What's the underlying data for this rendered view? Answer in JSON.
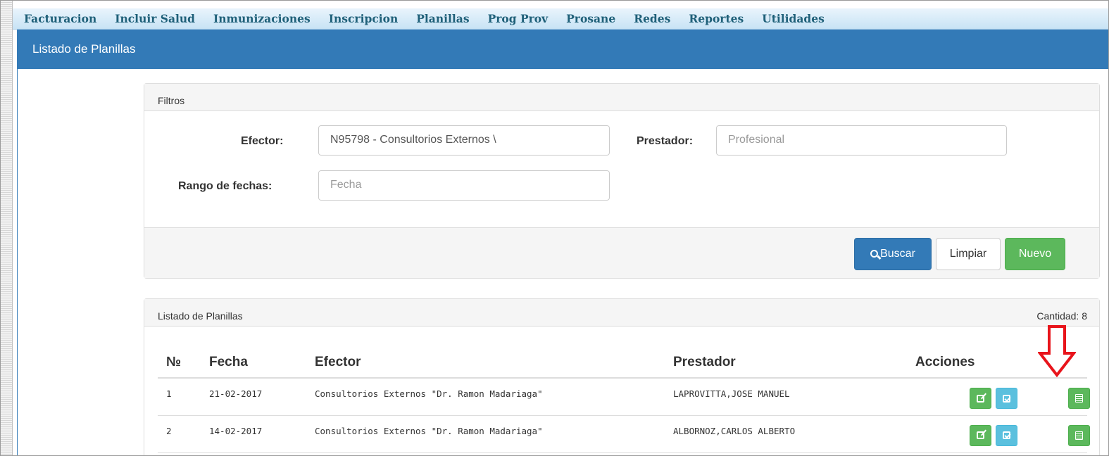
{
  "menu": {
    "items": [
      "Facturacion",
      "Incluir Salud",
      "Inmunizaciones",
      "Inscripcion",
      "Planillas",
      "Prog Prov",
      "Prosane",
      "Redes",
      "Reportes",
      "Utilidades"
    ]
  },
  "page": {
    "title": "Listado de Planillas"
  },
  "filters": {
    "heading": "Filtros",
    "efector_label": "Efector:",
    "efector_value": "N95798 - Consultorios Externos \\",
    "prestador_label": "Prestador:",
    "prestador_placeholder": "Profesional",
    "rango_label": "Rango de fechas:",
    "rango_placeholder": "Fecha",
    "buscar_label": "Buscar",
    "limpiar_label": "Limpiar",
    "nuevo_label": "Nuevo"
  },
  "listing": {
    "heading": "Listado de Planillas",
    "count_text": "Cantidad: 8",
    "columns": [
      "№",
      "Fecha",
      "Efector",
      "Prestador",
      "Acciones"
    ],
    "rows": [
      {
        "num": "1",
        "fecha": "21-02-2017",
        "efector": "Consultorios Externos \"Dr. Ramon Madariaga\"",
        "prestador": "LAPROVITTA,JOSE MANUEL"
      },
      {
        "num": "2",
        "fecha": "14-02-2017",
        "efector": "Consultorios Externos \"Dr. Ramon Madariaga\"",
        "prestador": "ALBORNOZ,CARLOS ALBERTO"
      }
    ]
  },
  "colors": {
    "primary": "#337ab7",
    "success": "#5cb85c",
    "info": "#5bc0de",
    "menu_text": "#1f6079",
    "annotation_arrow": "#e8141b"
  },
  "icons": [
    "search-icon",
    "edit-icon",
    "check-icon",
    "list-icon",
    "down-arrow-icon"
  ]
}
